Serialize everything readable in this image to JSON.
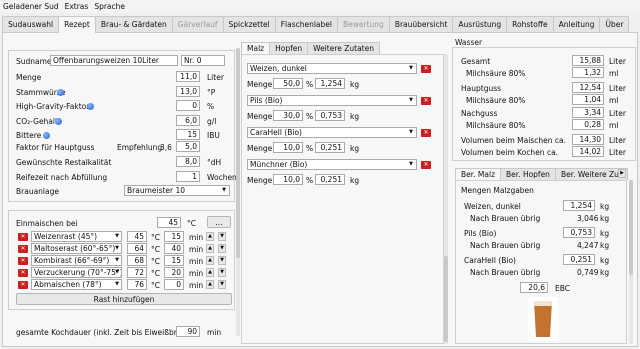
{
  "menu": [
    "Geladener Sud",
    "Extras",
    "Sprache"
  ],
  "tabs": [
    "Sudauswahl",
    "Rezept",
    "Brau- & Gärdaten",
    "Gärverlauf",
    "Spickzettel",
    "Flaschenlabel",
    "Bewertung",
    "Brauübersicht",
    "Ausrüstung",
    "Rohstoffe",
    "Anleitung",
    "Über"
  ],
  "active_tab": "Rezept",
  "disabled_tabs": [
    "Gärverlauf",
    "Bewertung"
  ],
  "recipe": {
    "sudname_label": "Sudname",
    "sudname_value": "Offenbarungsweizen 10Liter",
    "nr_value": "Nr. 0",
    "fields": [
      {
        "label": "Menge",
        "value": "11,0",
        "unit": "Liter",
        "info": false
      },
      {
        "label": "Stammwürze",
        "value": "13,0",
        "unit": "°P",
        "info": true
      },
      {
        "label": "High-Gravity-Faktor",
        "value": "0",
        "unit": "%",
        "info": true
      },
      {
        "label": "CO₂-Gehalt",
        "value": "6,0",
        "unit": "g/l",
        "info": true
      },
      {
        "label": "Bittere",
        "value": "15",
        "unit": "IBU",
        "info": true
      }
    ],
    "hopfen_label": "Faktor für Hauptguss",
    "empfehlung_label": "Empfehlung",
    "empfehlung_value": "3,6",
    "hopfen_value": "5,0",
    "restalk_label": "Gewünschte Restalkalität",
    "restalk_value": "8,0",
    "restalk_unit": "°dH",
    "reife_label": "Reifezeit nach Abfüllung",
    "reife_value": "1",
    "reife_unit": "Wochen",
    "brauanlage_label": "Brauanlage",
    "brauanlage_value": "Braumeister 10"
  },
  "mash": {
    "einmaischen_label": "Einmaischen bei",
    "einmaischen_value": "45",
    "einmaischen_unit": "°C",
    "dots": "...",
    "rasts": [
      {
        "name": "Weizenrast (45°)",
        "temp": "45",
        "dur": "15"
      },
      {
        "name": "Maltoserast (60°-65°)",
        "temp": "64",
        "dur": "40"
      },
      {
        "name": "Kombirast (66°-69°)",
        "temp": "68",
        "dur": "15"
      },
      {
        "name": "Verzuckerung (70°-75°)",
        "temp": "72",
        "dur": "20"
      },
      {
        "name": "Abmaischen (78°)",
        "temp": "76",
        "dur": "0"
      }
    ],
    "temp_unit": "°C",
    "dur_unit": "min",
    "add_button": "Rast hinzufügen",
    "kochdauer_label": "gesamte Kochdauer (inkl. Zeit bis Eiweißbruch)",
    "kochdauer_value": "90",
    "kochdauer_unit": "min"
  },
  "malz": {
    "tabs": [
      "Malz",
      "Hopfen",
      "Weitere Zutaten"
    ],
    "active": "Malz",
    "menge_label": "Menge",
    "items": [
      {
        "name": "Weizen, dunkel",
        "pct": "50,0",
        "kg": "1,254"
      },
      {
        "name": "Pils (Bio)",
        "pct": "30,0",
        "kg": "0,753"
      },
      {
        "name": "CaraHell (Bio)",
        "pct": "10,0",
        "kg": "0,251"
      },
      {
        "name": "Münchner (Bio)",
        "pct": "10,0",
        "kg": "0,251"
      }
    ],
    "pct_unit": "%",
    "kg_unit": "kg"
  },
  "wasser": {
    "title": "Wasser",
    "rows": [
      {
        "label": "Gesamt",
        "value": "15,88",
        "unit": "Liter",
        "indent": false
      },
      {
        "label": "Milchsäure 80%",
        "value": "1,32",
        "unit": "ml",
        "indent": true
      },
      {
        "label": "Hauptguss",
        "value": "12,54",
        "unit": "Liter",
        "indent": false
      },
      {
        "label": "Milchsäure 80%",
        "value": "1,04",
        "unit": "ml",
        "indent": true
      },
      {
        "label": "Nachguss",
        "value": "3,34",
        "unit": "Liter",
        "indent": false
      },
      {
        "label": "Milchsäure 80%",
        "value": "0,28",
        "unit": "ml",
        "indent": true
      },
      {
        "label": "Volumen beim Maischen ca.",
        "value": "14,30",
        "unit": "Liter",
        "indent": false
      },
      {
        "label": "Volumen beim Kochen ca.",
        "value": "14,02",
        "unit": "Liter",
        "indent": false
      }
    ]
  },
  "ber": {
    "tabs": [
      "Ber. Malz",
      "Ber. Hopfen",
      "Ber. Weitere Zut"
    ],
    "active": "Ber. Malz",
    "title": "Mengen Malzgaben",
    "items": [
      {
        "name": "Weizen, dunkel",
        "kg": "1,254",
        "rest": "3,046"
      },
      {
        "name": "Pils (Bio)",
        "kg": "0,753",
        "rest": "4,247"
      },
      {
        "name": "CaraHell (Bio)",
        "kg": "0,251",
        "rest": "0,749"
      }
    ],
    "rest_label": "Nach Brauen übrig",
    "kg_unit": "kg",
    "ebc_value": "20,6",
    "ebc_unit": "EBC",
    "beer_color": "#c4722f"
  }
}
